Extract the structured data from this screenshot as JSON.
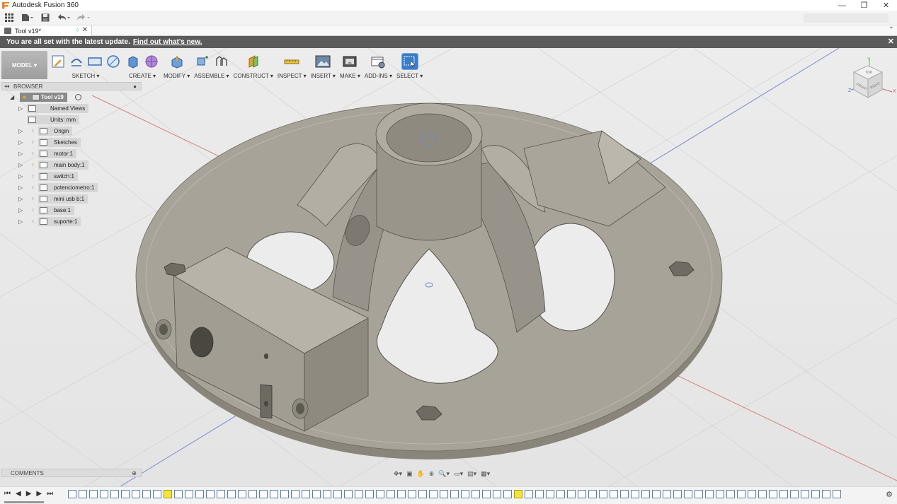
{
  "window": {
    "title": "Autodesk Fusion 360",
    "minimize": "—",
    "maximize": "❐",
    "close": "✕"
  },
  "document_tab": {
    "name": "Tool v19*",
    "sync": "○",
    "close": "✕"
  },
  "notification": {
    "message": "You are all set with the latest update.",
    "link": "Find out what's new.",
    "close": "✕"
  },
  "workspace": {
    "label": "MODEL ▾"
  },
  "toolbar_groups": [
    {
      "label": "SKETCH ▾"
    },
    {
      "label": "CREATE ▾"
    },
    {
      "label": "MODIFY ▾"
    },
    {
      "label": "ASSEMBLE ▾"
    },
    {
      "label": "CONSTRUCT ▾"
    },
    {
      "label": "INSPECT ▾"
    },
    {
      "label": "INSERT ▾"
    },
    {
      "label": "MAKE ▾"
    },
    {
      "label": "ADD-INS ▾"
    },
    {
      "label": "SELECT ▾"
    }
  ],
  "browser": {
    "title": "BROWSER",
    "root": "Tool v19",
    "items": [
      {
        "label": "Named Views"
      },
      {
        "label": "Units: mm"
      },
      {
        "label": "Origin"
      },
      {
        "label": "Sketches"
      },
      {
        "label": "motor:1"
      },
      {
        "label": "main body:1"
      },
      {
        "label": "switch:1"
      },
      {
        "label": "potenciometro:1"
      },
      {
        "label": "mini usb b:1"
      },
      {
        "label": "base:1"
      },
      {
        "label": "suporte:1"
      }
    ]
  },
  "comments": {
    "title": "COMMENTS"
  },
  "viewcube": {
    "top": "TOP",
    "front": "FRONT",
    "right": "RIGHT",
    "axis_x": "X",
    "axis_y": "Y",
    "axis_z": "Z"
  },
  "colors": {
    "accent": "#3b7cc8",
    "notify_bg": "#5b5b5b",
    "model": "#a8a398",
    "model_dark": "#8a857a",
    "timeline_highlight": "#f2e63a"
  }
}
